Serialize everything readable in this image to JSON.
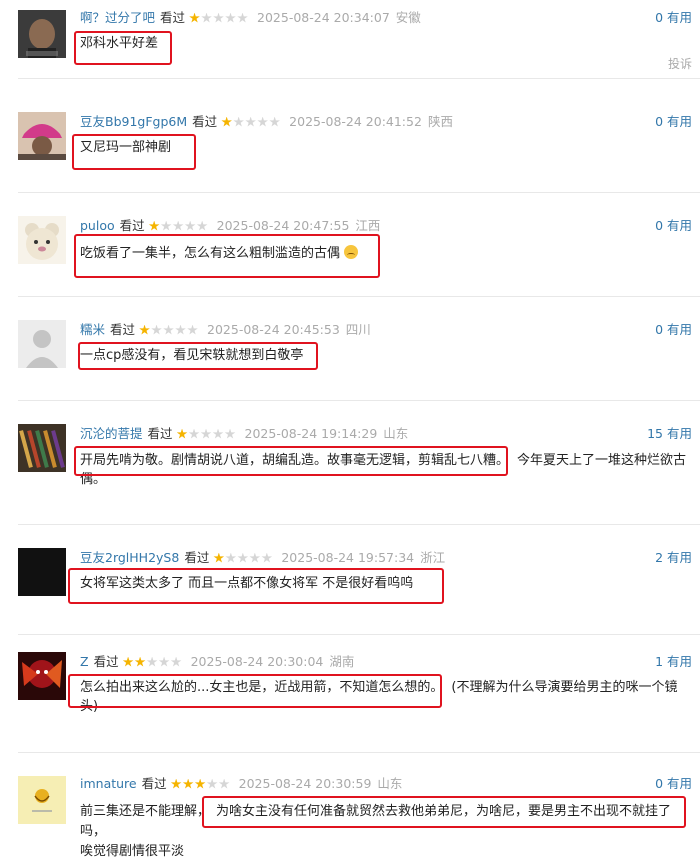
{
  "report_label": "投诉",
  "reviews": [
    {
      "user": "啊？过分了吧",
      "status": "看过",
      "stars": 1,
      "time": "2025-08-24 20:34:07",
      "location": "安徽",
      "useful": "0 有用",
      "comment": "邓科水平好差",
      "comment_rest": ""
    },
    {
      "user": "豆友Bb91gFgp6M",
      "status": "看过",
      "stars": 1,
      "time": "2025-08-24 20:41:52",
      "location": "陕西",
      "useful": "0 有用",
      "comment": "又尼玛一部神剧",
      "comment_rest": ""
    },
    {
      "user": "puloo",
      "status": "看过",
      "stars": 1,
      "time": "2025-08-24 20:47:55",
      "location": "江西",
      "useful": "0 有用",
      "comment": "吃饭看了一集半，怎么有这么粗制滥造的古偶",
      "comment_rest": ""
    },
    {
      "user": "糯米",
      "status": "看过",
      "stars": 1,
      "time": "2025-08-24 20:45:53",
      "location": "四川",
      "useful": "0 有用",
      "comment": "一点cp感没有，看见宋轶就想到白敬亭",
      "comment_rest": ""
    },
    {
      "user": "沉沦的菩提",
      "status": "看过",
      "stars": 1,
      "time": "2025-08-24 19:14:29",
      "location": "山东",
      "useful": "15 有用",
      "comment": "开局先啃为敬。剧情胡说八道，胡编乱造。故事毫无逻辑，剪辑乱七八糟。",
      "comment_rest": "今年夏天上了一堆这种烂欲古偶。"
    },
    {
      "user": "豆友2rglHH2yS8",
      "status": "看过",
      "stars": 1,
      "time": "2025-08-24 19:57:34",
      "location": "浙江",
      "useful": "2 有用",
      "comment": "女将军这类太多了 而且一点都不像女将军 不是很好看呜呜",
      "comment_rest": ""
    },
    {
      "user": "Z",
      "status": "看过",
      "stars": 2,
      "time": "2025-08-24 20:30:04",
      "location": "湖南",
      "useful": "1 有用",
      "comment": "怎么拍出来这么尬的...女主也是，近战用箭，不知道怎么想的。",
      "comment_rest": "(不理解为什么导演要给男主的咪一个镜头)"
    },
    {
      "user": "imnature",
      "status": "看过",
      "stars": 3,
      "time": "2025-08-24 20:30:59",
      "location": "山东",
      "useful": "0 有用",
      "comment_pre": "前三集还是不能理解，",
      "comment": "为啥女主没有任何准备就贸然去救他弟弟尼，为啥尼，要是男主不出现不就挂了吗，",
      "comment_rest": "唉觉得剧情很平淡"
    }
  ]
}
